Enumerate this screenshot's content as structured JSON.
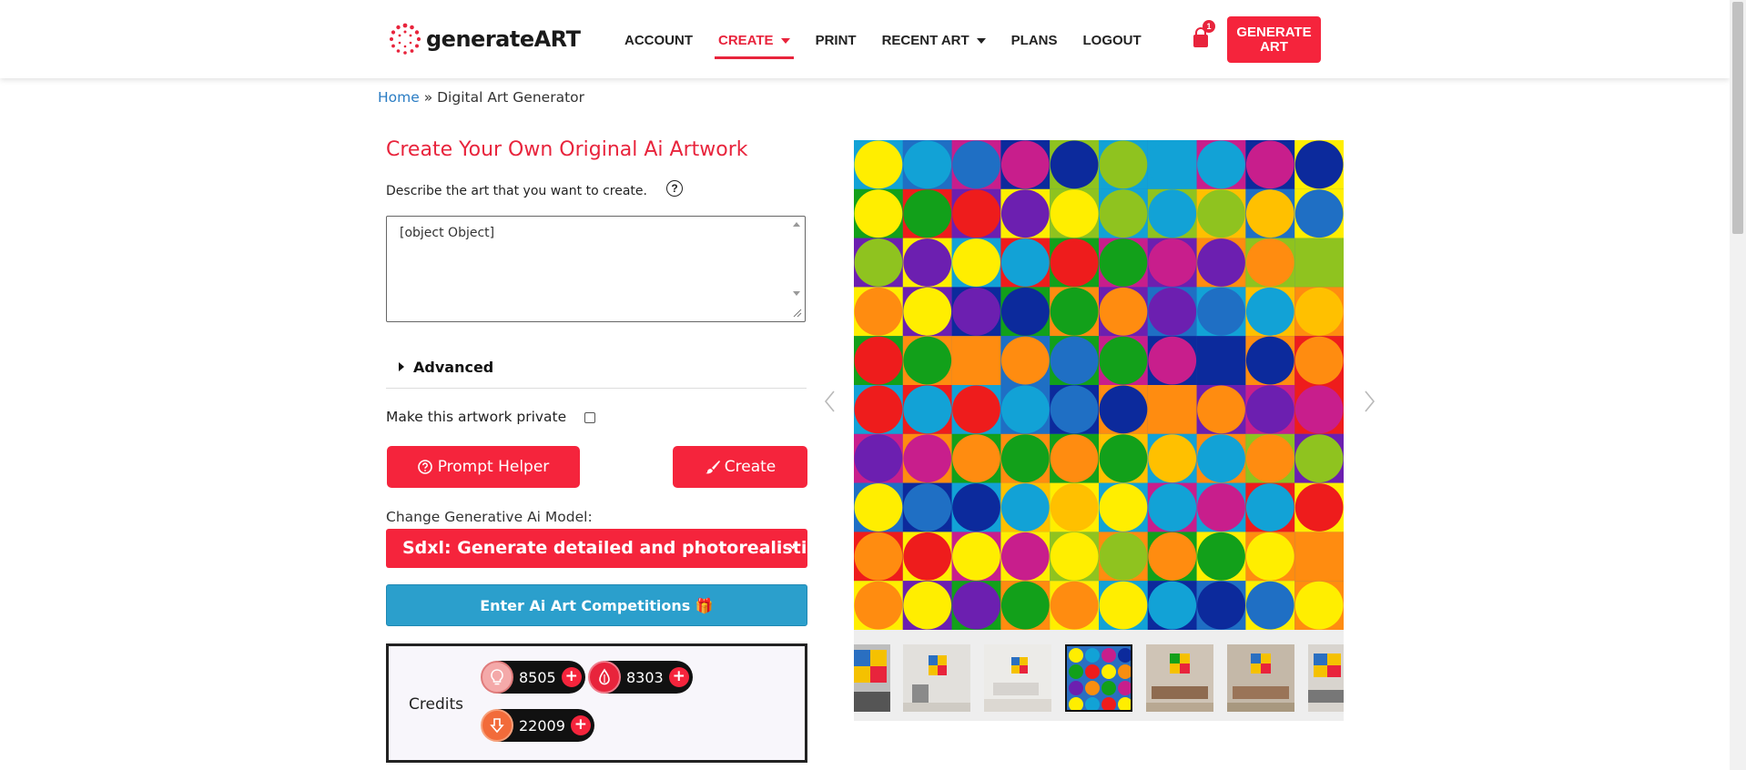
{
  "header": {
    "logo_text": "generateART",
    "nav": [
      {
        "label": "ACCOUNT",
        "active": false,
        "caret": false
      },
      {
        "label": "CREATE",
        "active": true,
        "caret": true
      },
      {
        "label": "PRINT",
        "active": false,
        "caret": false
      },
      {
        "label": "RECENT ART",
        "active": false,
        "caret": true
      },
      {
        "label": "PLANS",
        "active": false,
        "caret": false
      },
      {
        "label": "LOGOUT",
        "active": false,
        "caret": false
      }
    ],
    "cart_count": "1",
    "generate_button_line1": "GENERATE",
    "generate_button_line2": "ART"
  },
  "breadcrumb": {
    "home": "Home",
    "separator": " » ",
    "current": "Digital Art Generator"
  },
  "form": {
    "title": "Create Your Own Original Ai Artwork",
    "describe_label": "Describe the art that you want to create.",
    "help_icon": "?",
    "prompt_value": "[object Object]",
    "advanced_label": "Advanced",
    "private_label": "Make this artwork private",
    "private_checked": false,
    "prompt_helper_label": "Prompt Helper",
    "create_label": "Create",
    "model_label": "Change Generative Ai Model:",
    "model_selected": "Sdxl: Generate detailed and photorealistic",
    "competitions_label": "Enter Ai Art Competitions 🎁",
    "credits_label": "Credits",
    "credits": [
      {
        "icon": "lightbulb-icon",
        "value": "8505",
        "color": "#f4a9a9"
      },
      {
        "icon": "drop-icon",
        "value": "8303",
        "color": "#e8243c"
      },
      {
        "icon": "download-icon",
        "value": "22009",
        "color": "#f26b3a"
      }
    ]
  },
  "colors": {
    "accent": "#f5243c",
    "link": "#2b7dc4",
    "competition": "#2b9fcc"
  }
}
